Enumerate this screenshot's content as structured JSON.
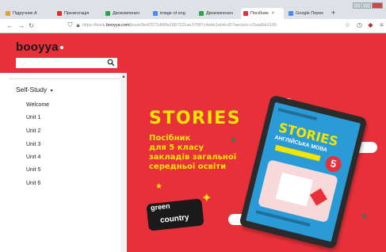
{
  "browser": {
    "tabs": [
      {
        "label": "Підручник А",
        "favicon_color": "#e0a040"
      },
      {
        "label": "Презентація",
        "favicon_color": "#e0302a"
      },
      {
        "label": "Двокомпонен",
        "favicon_color": "#2ca34a"
      },
      {
        "label": "image of eng",
        "favicon_color": "#4a8af4"
      },
      {
        "label": "Двокомпонен",
        "favicon_color": "#2ca34a"
      },
      {
        "label": "Посібник",
        "favicon_color": "#e8303a"
      },
      {
        "label": "Google Перек",
        "favicon_color": "#4a8af4"
      }
    ],
    "active_tab_index": 5,
    "url_prefix": "https://book.",
    "url_domain": "booyya.com",
    "url_rest": "/book/9e42571d08fa1867121ae37f9f7c4ebb1eb4cd5?section-c/Saafbb3195"
  },
  "site": {
    "logo_text": "booyya",
    "search_placeholder": "",
    "accent_color": "#e8303a"
  },
  "sidebar": {
    "section_title": "Self-Study",
    "items": [
      {
        "label": "Welcome"
      },
      {
        "label": "Unit 1"
      },
      {
        "label": "Unit 2"
      },
      {
        "label": "Unit 3"
      },
      {
        "label": "Unit 4"
      },
      {
        "label": "Unit 5"
      },
      {
        "label": "Unit 6"
      }
    ]
  },
  "content": {
    "headline": "STORIES",
    "sub_lines": [
      "Посібник",
      "для 5 класу",
      "закладів загальної",
      "середньої освіти"
    ],
    "badge_line1": "green",
    "badge_line2": "country",
    "tablet_title": "STORIES",
    "tablet_subtitle": "АНГЛІЙСЬКА МОВА",
    "tablet_grade": "5"
  }
}
